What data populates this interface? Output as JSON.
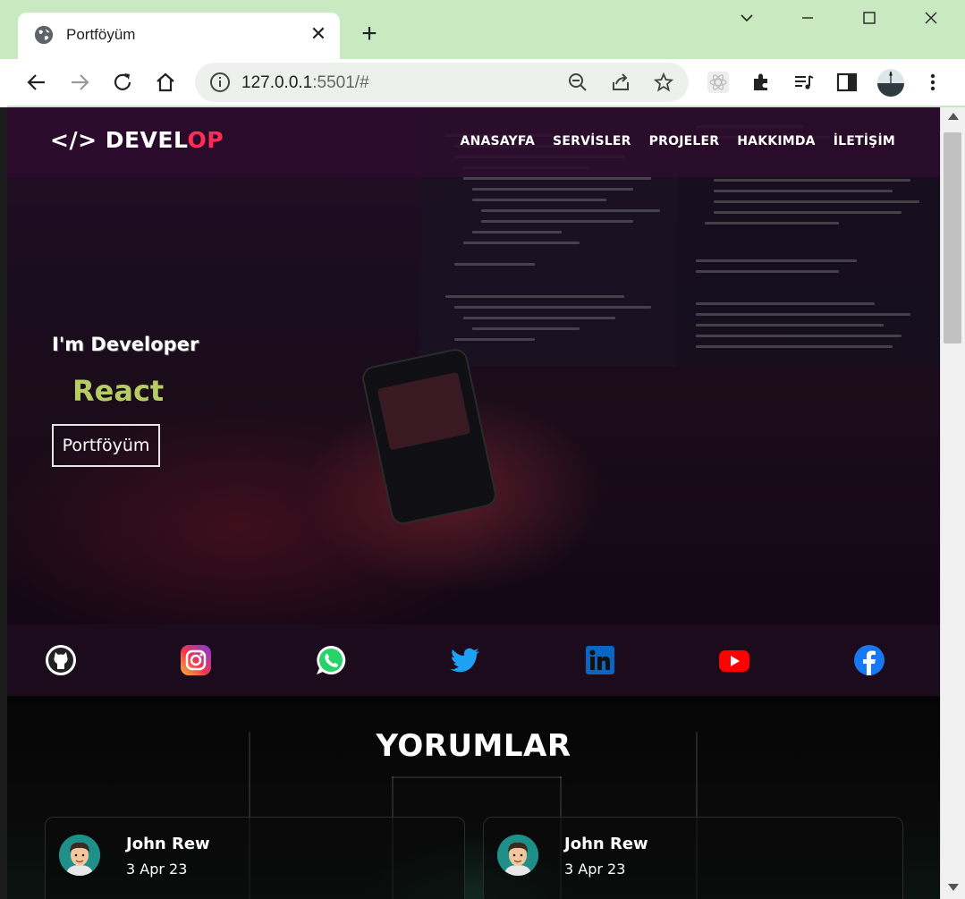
{
  "browser": {
    "tab_title": "Portföyüm",
    "url_host": "127.0.0.1",
    "url_rest": ":5501/#",
    "new_tab_glyph": "+",
    "close_tab_glyph": "✕"
  },
  "site": {
    "logo_prefix": "</> DEVEL",
    "logo_accent": "OP",
    "nav": [
      "ANASAYFA",
      "SERVİSLER",
      "PROJELER",
      "HAKKIMDA",
      "İLETİŞİM"
    ],
    "greeting": "I'm Developer",
    "role": "React",
    "cta_label": "Portföyüm"
  },
  "social_icons": [
    "github-icon",
    "instagram-icon",
    "whatsapp-icon",
    "twitter-icon",
    "linkedin-icon",
    "youtube-icon",
    "facebook-icon"
  ],
  "comments": {
    "title": "YORUMLAR",
    "items": [
      {
        "name": "John Rew",
        "date": "3 Apr 23"
      },
      {
        "name": "John Rew",
        "date": "3 Apr 23"
      }
    ]
  },
  "colors": {
    "logo_accent": "#ff2d55",
    "role_text": "#b5cc63",
    "titlebar": "#c9e9c0"
  }
}
